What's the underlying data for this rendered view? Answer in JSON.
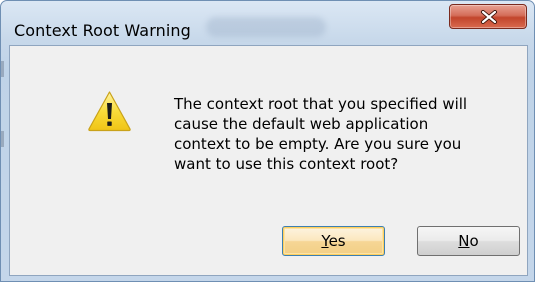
{
  "window": {
    "title": "Context Root Warning",
    "close_icon": "close-x-icon"
  },
  "dialog": {
    "icon": "warning-triangle-icon",
    "message": "The context root that you specified will\ncause the default web application\ncontext to be empty.  Are you sure you\nwant to use this context root?"
  },
  "buttons": {
    "yes": {
      "mnemonic": "Y",
      "rest": "es",
      "is_default": true
    },
    "no": {
      "mnemonic": "N",
      "rest": "o",
      "is_default": false
    }
  },
  "colors": {
    "close_button": "#c9513a",
    "warning_yellow": "#f5d12a",
    "default_button_glow": "#ffcf5e"
  }
}
